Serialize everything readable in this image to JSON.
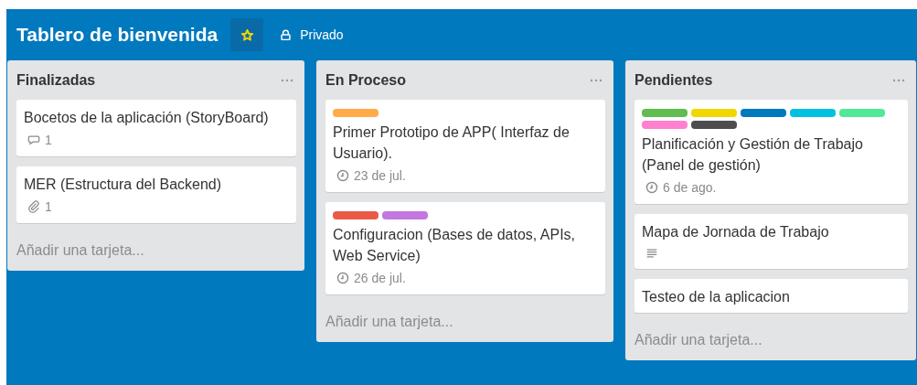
{
  "board": {
    "title": "Tablero de bienvenida",
    "starred": true,
    "visibility": "Privado"
  },
  "lists": [
    {
      "title": "Finalizadas",
      "add_card": "Añadir una tarjeta...",
      "cards": [
        {
          "title": "Bocetos de la aplicación (StoryBoard)",
          "badges": [
            {
              "kind": "comments",
              "text": "1"
            }
          ]
        },
        {
          "title": "MER (Estructura del Backend)",
          "badges": [
            {
              "kind": "attachments",
              "text": "1"
            }
          ]
        }
      ]
    },
    {
      "title": "En Proceso",
      "add_card": "Añadir una tarjeta...",
      "cards": [
        {
          "labels": [
            {
              "color": "#ffab4a"
            }
          ],
          "title": "Primer Prototipo de APP( Interfaz de Usuario).",
          "badges": [
            {
              "kind": "due",
              "text": "23 de jul."
            }
          ]
        },
        {
          "labels": [
            {
              "color": "#eb5a46"
            },
            {
              "color": "#c377e0"
            }
          ],
          "title": "Configuracion (Bases de datos, APIs, Web Service)",
          "badges": [
            {
              "kind": "due",
              "text": "26 de jul."
            }
          ]
        }
      ]
    },
    {
      "title": "Pendientes",
      "add_card": "Añadir una tarjeta...",
      "cards": [
        {
          "labels": [
            {
              "color": "#61bd4f"
            },
            {
              "color": "#f2d600"
            },
            {
              "color": "#0079bf"
            },
            {
              "color": "#00c2e0"
            },
            {
              "color": "#51e898"
            },
            {
              "color": "#ff80ce"
            },
            {
              "color": "#4d4d4d"
            }
          ],
          "title": "Planificación y Gestión de Trabajo (Panel de gestión)",
          "badges": [
            {
              "kind": "due",
              "text": "6 de ago."
            }
          ]
        },
        {
          "title": "Mapa de Jornada de Trabajo",
          "badges": [
            {
              "kind": "description"
            }
          ]
        },
        {
          "title": "Testeo de la aplicacion"
        }
      ]
    }
  ]
}
